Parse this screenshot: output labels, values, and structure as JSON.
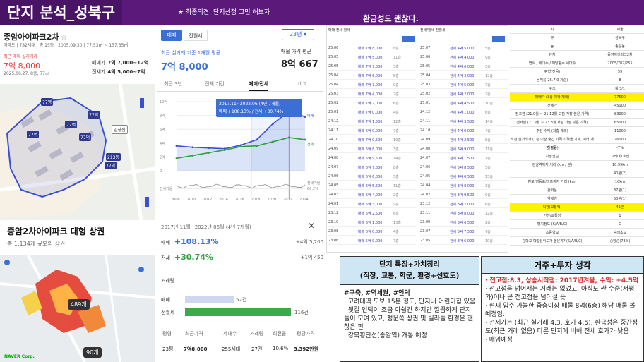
{
  "header": {
    "title": "단지 분석_성북구",
    "memo": "★ 최종의견: 단지선정 고민 해보자",
    "note": "환금성도 괜찮다."
  },
  "left": {
    "apt_name": "종암아이파크2차",
    "apt_meta": "아파트 | 782세대 | 총 15동 | 2005.09.30 | 77.53㎡ ~ 137.35㎡",
    "recent_label": "최근 매매 실거래가",
    "recent_price": "7억 8,000",
    "recent_date": "2025.06.27. 8층, 77㎡",
    "sale_label": "매매가",
    "sale_value": "7억 7,000~12억",
    "jeonse_label": "전세가",
    "jeonse_value": "4억 5,000~7억",
    "map_labels": [
      "77평",
      "77억",
      "77억",
      "77억",
      "77억",
      "213동",
      "77억",
      "임장센"
    ],
    "big_title": "종암2차아이파크 대형 상권",
    "big_sub": "총 1,134개 규모의 상권",
    "cluster1": "489개",
    "cluster2": "90개",
    "naver": "NAVER Corp."
  },
  "middle": {
    "tab_sale": "매매",
    "tab_jeonse": "전월세",
    "size": "23평 ▾",
    "avg_label": "최근 실거래 기준 1개월 평균",
    "avg_price": "7억 8,000",
    "sale_avg_label": "매물 가격 평균",
    "sale_avg_price": "8억 667",
    "ptabs": [
      "최근 3년",
      "전체 기간",
      "매매/전세",
      "비교"
    ],
    "tooltip_period": "2017.11~2022.06 (4년 7개월)",
    "tooltip_sale": "매매 +108.13%",
    "tooltip_jeonse": "전세 +30.74%",
    "period": "2017년 11월~2022년 06월 (4년 7개월)",
    "close": "✕",
    "sale_label": "매매",
    "sale_pct": "+108.13%",
    "sale_amt": "+4억 5,200",
    "jeonse_label": "전세",
    "jeonse_pct": "+30.74%",
    "jeonse_amt": "+1억 450",
    "vol_title": "거래량",
    "vol_sale_label": "매매",
    "vol_sale_num": "52건",
    "vol_jeonse_label": "전월세",
    "vol_jeonse_num": "116건",
    "stats_headers": [
      "평형",
      "최근가격",
      "세대수",
      "거래량",
      "회전율",
      "평당가격"
    ],
    "stats_values": [
      "23평",
      "7억8,000",
      "255세대",
      "27건",
      "10.6%",
      "3,392만원"
    ]
  },
  "chart_data": {
    "type": "line",
    "x": [
      "2008",
      "2010",
      "2012",
      "2014",
      "2016",
      "2018",
      "2020",
      "2022",
      "2024"
    ],
    "series": [
      {
        "name": "매매",
        "values": [
          3.6,
          3.4,
          3.3,
          3.2,
          3.7,
          4.5,
          6.8,
          8.6,
          7.8
        ]
      },
      {
        "name": "전세",
        "values": [
          1.8,
          2.2,
          2.6,
          3.0,
          3.5,
          3.6,
          4.2,
          4.8,
          4.5
        ]
      }
    ],
    "ylabel": "",
    "y_ticks": [
      "10억",
      "8억",
      "6억",
      "4억",
      "2억",
      "0"
    ],
    "ylim": [
      0,
      10
    ],
    "side_labels": [
      "매매",
      "전세",
      "전세가율"
    ],
    "ratio_label": "전세가율",
    "ratio_value": "66.2%"
  },
  "transactions": {
    "left_head": "매매 전세 월세",
    "right_head": "전세/월세 전월세",
    "left_rows": [
      {
        "d": "25.06",
        "p": "매매 7억 8,000",
        "f": "8층"
      },
      {
        "d": "25.05",
        "p": "매매 7억 5,000",
        "f": "11층"
      },
      {
        "d": "25.05",
        "p": "매매 7억 7,000",
        "f": "3층"
      },
      {
        "d": "25.04",
        "p": "매매 7억 6,000",
        "f": "5층"
      },
      {
        "d": "25.04",
        "p": "매매 7억 3,000",
        "f": "9층"
      },
      {
        "d": "25.03",
        "p": "매매 7억 4,000",
        "f": "2층"
      },
      {
        "d": "25.02",
        "p": "매매 7억 2,000",
        "f": "6층"
      },
      {
        "d": "25.01",
        "p": "매매 7억 0,000",
        "f": "4층"
      },
      {
        "d": "24.12",
        "p": "매매 7억 1,500",
        "f": "12층"
      },
      {
        "d": "24.11",
        "p": "매매 6억 9,000",
        "f": "7층"
      },
      {
        "d": "24.10",
        "p": "매매 7억 0,500",
        "f": "10층"
      },
      {
        "d": "24.09",
        "p": "매매 6억 8,000",
        "f": "3층"
      },
      {
        "d": "24.08",
        "p": "매매 6억 9,500",
        "f": "14층"
      },
      {
        "d": "24.07",
        "p": "매매 6억 7,000",
        "f": "8층"
      },
      {
        "d": "24.06",
        "p": "매매 6억 6,000",
        "f": "5층"
      },
      {
        "d": "24.05",
        "p": "매매 6억 5,500",
        "f": "11층"
      },
      {
        "d": "24.03",
        "p": "매매 6억 4,000",
        "f": "2층"
      },
      {
        "d": "24.01",
        "p": "매매 6억 3,000",
        "f": "9층"
      },
      {
        "d": "23.12",
        "p": "매매 6억 2,500",
        "f": "6층"
      },
      {
        "d": "23.10",
        "p": "매매 6억 1,000",
        "f": "13층"
      },
      {
        "d": "23.08",
        "p": "매매 6억 0,000",
        "f": "4층"
      },
      {
        "d": "23.06",
        "p": "매매 5억 9,000",
        "f": "7층"
      }
    ],
    "right_rows": [
      {
        "d": "25.07",
        "p": "전세 4억 5,000",
        "f": "5층"
      },
      {
        "d": "25.06",
        "p": "전세 4억 4,000",
        "f": "9층"
      },
      {
        "d": "25.05",
        "p": "전세 4억 6,000",
        "f": "3층"
      },
      {
        "d": "25.04",
        "p": "전세 4억 3,000",
        "f": "12층"
      },
      {
        "d": "25.03",
        "p": "전세 4억 5,000",
        "f": "7층"
      },
      {
        "d": "25.02",
        "p": "전세 4억 2,000",
        "f": "2층"
      },
      {
        "d": "25.01",
        "p": "전세 4억 4,500",
        "f": "10층"
      },
      {
        "d": "24.12",
        "p": "전세 4억 1,000",
        "f": "6층"
      },
      {
        "d": "24.11",
        "p": "전세 4억 3,500",
        "f": "14층"
      },
      {
        "d": "24.10",
        "p": "전세 4억 0,000",
        "f": "4층"
      },
      {
        "d": "24.09",
        "p": "전세 4억 2,500",
        "f": "8층"
      },
      {
        "d": "24.08",
        "p": "전세 3억 9,000",
        "f": "11층"
      },
      {
        "d": "24.07",
        "p": "전세 4억 1,500",
        "f": "1층"
      },
      {
        "d": "24.06",
        "p": "전세 3억 8,500",
        "f": "5층"
      },
      {
        "d": "24.05",
        "p": "전세 4억 0,500",
        "f": "13층"
      },
      {
        "d": "24.04",
        "p": "전세 3억 8,000",
        "f": "3층"
      },
      {
        "d": "24.02",
        "p": "전세 3억 9,500",
        "f": "9층"
      },
      {
        "d": "23.12",
        "p": "전세 3억 7,000",
        "f": "6층"
      },
      {
        "d": "23.11",
        "p": "전세 3억 8,000",
        "f": "12층"
      },
      {
        "d": "23.09",
        "p": "전세 3억 6,500",
        "f": "2층"
      },
      {
        "d": "23.07",
        "p": "전세 3억 7,500",
        "f": "7층"
      },
      {
        "d": "23.05",
        "p": "전세 3억 6,000",
        "f": "10층"
      }
    ]
  },
  "spec": {
    "rows": [
      {
        "k": "시",
        "v": "서울"
      },
      {
        "k": "구",
        "v": "성북구"
      },
      {
        "k": "동",
        "v": "종암동"
      },
      {
        "k": "단지",
        "v": "종암아이파크2차"
      },
      {
        "k": "연식 / 세대수 / 해당평수 세대수",
        "v": "2005/782/255"
      },
      {
        "k": "평형(전용)",
        "v": "59"
      },
      {
        "k": "용적률(25.7.0 기준)",
        "v": "8"
      },
      {
        "k": "구조",
        "v": "계 3/1"
      },
      {
        "k": "매매가 (3층 이하 제외)",
        "v": "77500"
      },
      {
        "k": "전세가",
        "v": "45000"
      },
      {
        "k": "전고점 (21.9월 ~ 21.12월 고점 가장 높은 가격)",
        "v": "83000"
      },
      {
        "k": "전저점 (21.9월 ~ 23.3월 저점 가장 낮은 가격)",
        "v": "65000"
      },
      {
        "k": "주선 수익 (저층 제외)",
        "v": "11000"
      },
      {
        "k": "직전 실거래가 (1층 이상 출간 가격 가격을 기재, 여러 개면 평균)",
        "v": "76000"
      },
      {
        "k": "하락률",
        "v": "-7%"
      },
      {
        "k": "직장접근",
        "v": "고려대1호선"
      },
      {
        "k": "강남역까지 거리 (km / 분)",
        "v": "10.95km"
      },
      {
        "k": "",
        "v": "40분(2)"
      },
      {
        "k": "반포/영등포/마포까지 거리 (km)",
        "v": "10km"
      },
      {
        "k": "광화문",
        "v": "37분(1)"
      },
      {
        "k": "역세권",
        "v": "50분(1)"
      },
      {
        "k": "직장(교통택)",
        "v": "41분"
      },
      {
        "k": "안전/교통망",
        "v": "1"
      },
      {
        "k": "평지정도 (S/A/B/C)",
        "v": "C"
      },
      {
        "k": "초등학교",
        "v": "숭례초교"
      },
      {
        "k": "중학교 학업성취도가 높은가? (S/A/B/C)",
        "v": "중앙중(73%)"
      }
    ],
    "side_labels": [
      "교통",
      "환경 (반경 1km이내)",
      "학군 (근거리 중학교)"
    ]
  },
  "box1": {
    "title_line1": "단지 특징+가치정리",
    "title_line2": "(직장, 교통, 학군, 환경+선호도)",
    "lines": [
      "#구축, #역세권, #언덕",
      "· 고려대역 도보 15분 정도, 단지내 어린이집 있음",
      "· 뒷길 언덕이 조금 아쉽긴 하지만 깔끔하게 단지들이 모여 있고, 정문쪽 상권 및 빌라들 환경은 괜찮은 편",
      "· 강북횡단선(종암역) 개통 예정"
    ]
  },
  "box2": {
    "title": "거주+투자 생각",
    "highlight": "· 전고점:8.3, 상승시작점: 2017년겨울, 수익: +4.5억",
    "lines": [
      "· 전고점을 넘어서는 거래는 없었고, 아직도 싼 수준(저평가)이나 곧 전고점을 넘어설 듯",
      "· 현재 입주 가능한 중층이상 매물 8억(6층) 해당 매물 볼 예정임.",
      "· 전세가는 (최근 실거래 4.3, 호가 4.5), 환금성은 중간정도(최근 거래 없음) 다른 단지에 비해 전세 호가가 낮음",
      "· 매임예정"
    ]
  },
  "colors": {
    "header_bg": "#5b1a7a",
    "accent_blue": "#3b6fd6",
    "sale_line": "#3b4fd6",
    "jeonse_line": "#2e9e3e",
    "box_head_bg": "#cfe6f5",
    "highlight_red": "#d8262b",
    "highlight_yellow": "#fff200"
  }
}
